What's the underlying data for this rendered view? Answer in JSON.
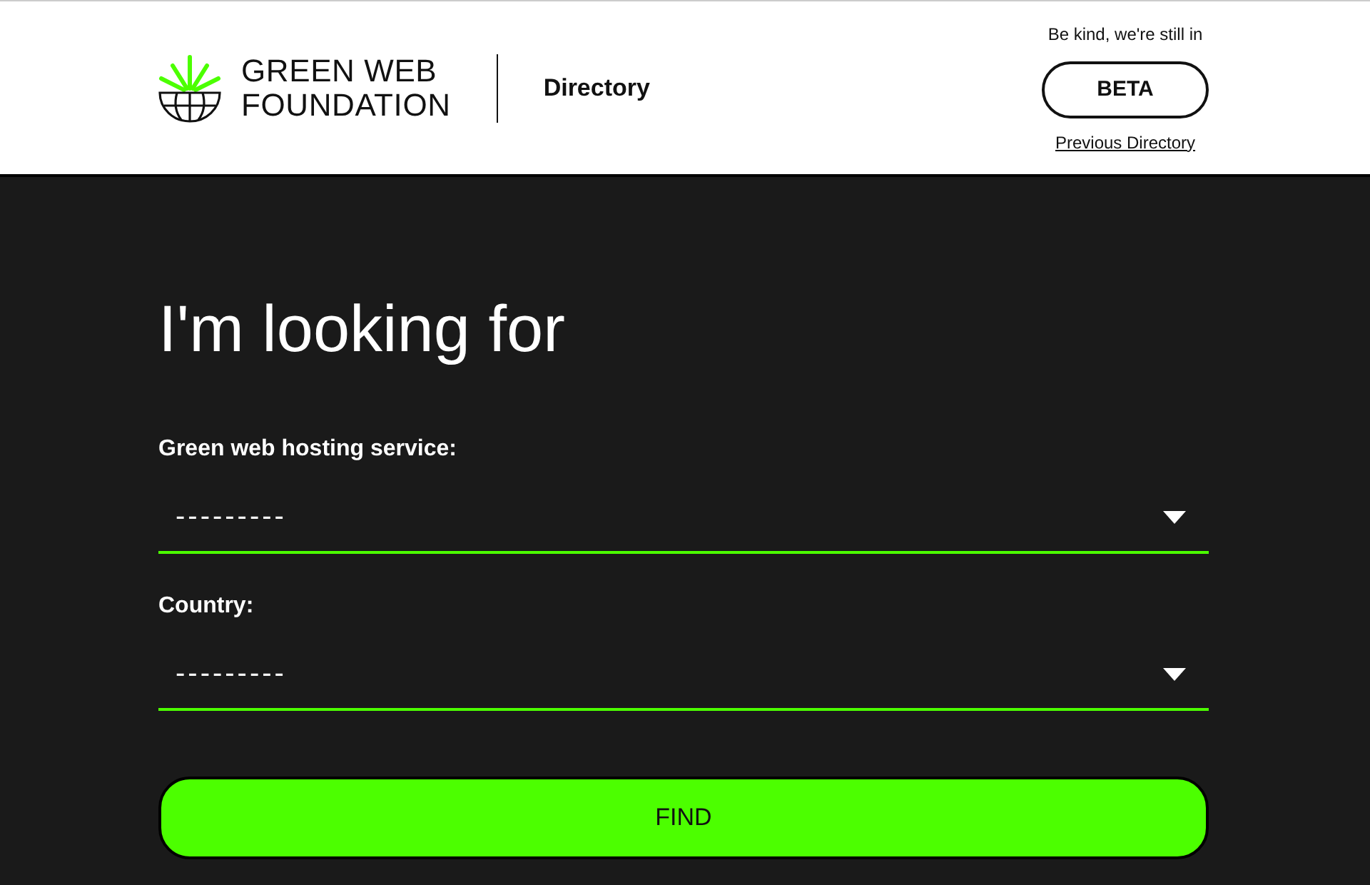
{
  "header": {
    "logo_text": [
      "GREEN WEB",
      "FOUNDATION"
    ],
    "section": "Directory",
    "beta_note": "Be kind, we're still in",
    "beta_button": "BETA",
    "previous_link": "Previous Directory"
  },
  "search": {
    "heading": "I'm looking for",
    "fields": [
      {
        "label": "Green web hosting service:",
        "value": "---------"
      },
      {
        "label": "Country:",
        "value": "---------"
      }
    ],
    "submit": "FIND"
  }
}
